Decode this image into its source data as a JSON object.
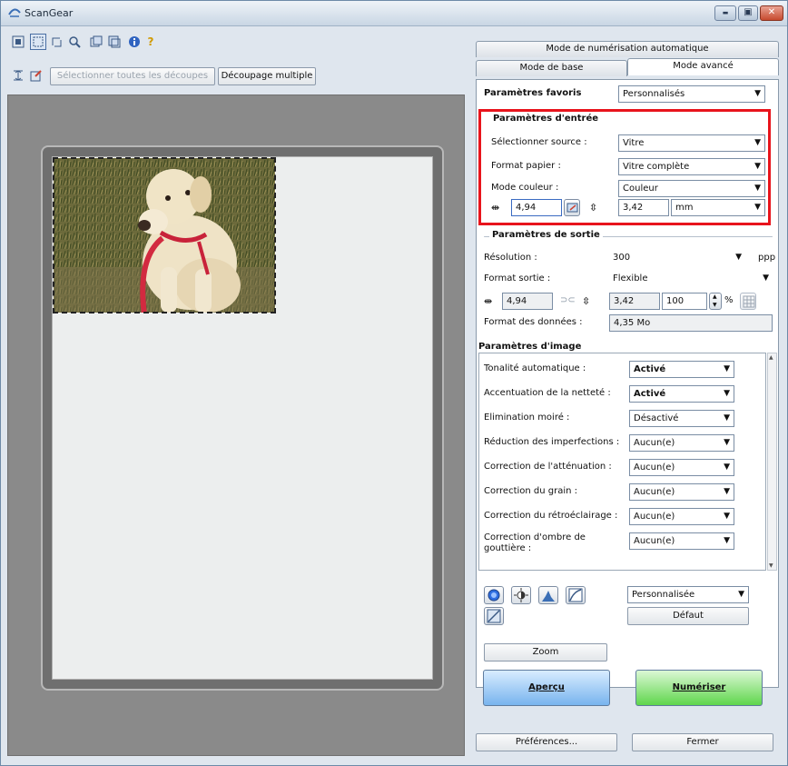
{
  "window": {
    "title": "ScanGear",
    "buttons": {
      "minimize": "▬",
      "maximize": "▣",
      "close": "✕"
    }
  },
  "toolbar": {
    "icons": [
      "fit-icon",
      "crop-icon",
      "rotate-icon",
      "zoom-icon",
      "scan-frame-icon",
      "frame-icon",
      "info-icon",
      "help-icon"
    ],
    "select_all_crops": "Sélectionner toutes les découpes",
    "multi_crop": "Découpage multiple"
  },
  "tabs": {
    "auto_mode": "Mode de numérisation automatique",
    "basic_mode": "Mode de base",
    "advanced_mode": "Mode avancé"
  },
  "favorites": {
    "label": "Paramètres favoris",
    "value": "Personnalisés"
  },
  "input_settings": {
    "title": "Paramètres d'entrée",
    "source_label": "Sélectionner source :",
    "source_value": "Vitre",
    "paper_label": "Format papier :",
    "paper_value": "Vitre complète",
    "color_label": "Mode couleur :",
    "color_value": "Couleur",
    "width": "4,94",
    "height": "3,42",
    "unit": "mm"
  },
  "output_settings": {
    "title": "Paramètres de sortie",
    "resolution_label": "Résolution :",
    "resolution_value": "300",
    "resolution_unit": "ppp",
    "format_label": "Format sortie :",
    "format_value": "Flexible",
    "width": "4,94",
    "height": "3,42",
    "scale": "100",
    "scale_unit": "%",
    "data_size_label": "Format des données :",
    "data_size_value": "4,35 Mo"
  },
  "image_settings": {
    "title": "Paramètres d'image",
    "rows": [
      {
        "label": "Tonalité automatique :",
        "value": "Activé",
        "bold": true
      },
      {
        "label": "Accentuation de la netteté :",
        "value": "Activé",
        "bold": true
      },
      {
        "label": "Elimination moiré :",
        "value": "Désactivé",
        "bold": false
      },
      {
        "label": "Réduction des imperfections :",
        "value": "Aucun(e)",
        "bold": false
      },
      {
        "label": "Correction de l'atténuation :",
        "value": "Aucun(e)",
        "bold": false
      },
      {
        "label": "Correction du grain :",
        "value": "Aucun(e)",
        "bold": false
      },
      {
        "label": "Correction du rétroéclairage :",
        "value": "Aucun(e)",
        "bold": false
      },
      {
        "label": "Correction d'ombre de gouttière :",
        "value": "Aucun(e)",
        "bold": false
      }
    ]
  },
  "adjust": {
    "preset_value": "Personnalisée",
    "default_label": "Défaut"
  },
  "actions": {
    "zoom": "Zoom",
    "preview": "Aperçu",
    "scan": "Numériser",
    "preferences": "Préférences...",
    "close": "Fermer"
  }
}
